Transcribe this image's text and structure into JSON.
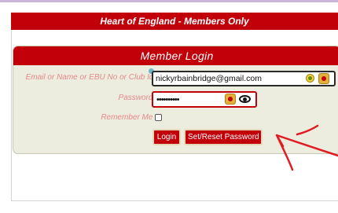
{
  "page": {
    "header_title": "Heart of England - Members Only"
  },
  "login_panel": {
    "title": "Member Login",
    "email": {
      "label": "Email or Name or EBU No or Club Id :",
      "value": "nickyrbainbridge@gmail.com"
    },
    "password": {
      "label": "Password :",
      "value": "••••••••••"
    },
    "remember_me": {
      "label": "Remember Me :",
      "checked": false
    },
    "buttons": {
      "login": "Login",
      "set_reset": "Set/Reset Password"
    }
  },
  "annotation": {
    "color": "#e01b22"
  },
  "icons": {
    "extension": "extension-icon",
    "autofill_key": "password-manager-key-icon",
    "show_password": "eye-icon"
  },
  "colors": {
    "brand_red": "#c1000a",
    "panel_bg": "#ececdf",
    "label_text": "#e58a8a"
  }
}
